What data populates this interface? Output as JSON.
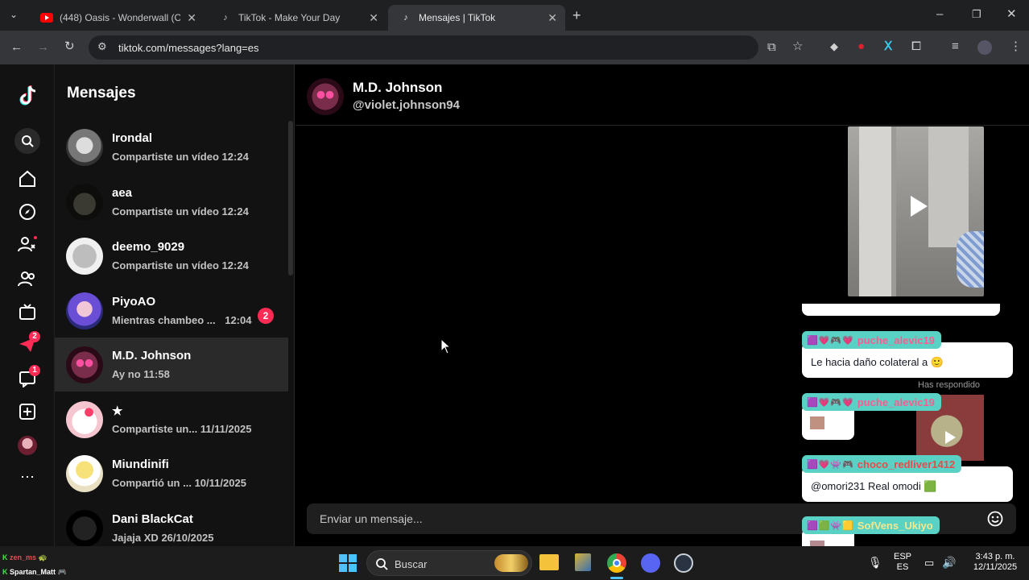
{
  "browser": {
    "tabs": [
      {
        "title": "(448) Oasis - Wonderwall (Offic",
        "icon": "youtube-icon"
      },
      {
        "title": "TikTok - Make Your Day",
        "icon": "tiktok-icon"
      },
      {
        "title": "Mensajes | TikTok",
        "icon": "tiktok-icon",
        "active": true
      }
    ],
    "url": "tiktok.com/messages?lang=es"
  },
  "nav": {
    "badges": {
      "inbox": "2",
      "activity": "1"
    }
  },
  "conversations": {
    "title": "Mensajes",
    "items": [
      {
        "name": "Irondal",
        "preview": "Compartiste un vídeo",
        "time": "12:24"
      },
      {
        "name": "aea",
        "preview": "Compartiste un vídeo",
        "time": "12:24"
      },
      {
        "name": "deemo_9029",
        "preview": "Compartiste un vídeo",
        "time": "12:24"
      },
      {
        "name": "PiyoAO",
        "preview": "Mientras chambeo ...",
        "time": "12:04",
        "unread": "2"
      },
      {
        "name": "M.D. Johnson",
        "preview": "Ay no",
        "time": "11:58",
        "selected": true
      },
      {
        "name": "★",
        "preview": "Compartiste un...",
        "time": "11/11/2025"
      },
      {
        "name": "Miundinifi",
        "preview": "Compartió un ...",
        "time": "10/11/2025"
      },
      {
        "name": "Dani BlackCat",
        "preview": "Jajaja XD",
        "time": "26/10/2025"
      }
    ]
  },
  "chat": {
    "name": "M.D. Johnson",
    "handle": "@violet.johnson94",
    "replied_label": "Has respondido",
    "composer_placeholder": "Enviar un mensaje..."
  },
  "stream_overlay": {
    "messages": [
      {
        "user": "puche_alevic19",
        "emotes": "🟪💗🎮💗",
        "text": "Le hacia daño colateral a 🙂"
      },
      {
        "user": "puche_alevic19",
        "emotes": "🟪💗🎮💗",
        "text": ""
      },
      {
        "user": "choco_redliver1412",
        "emotes": "🟪💗👾🎮",
        "text": "@omori231 Real omodi 🟩"
      },
      {
        "user": "SofVens_Ukiyo",
        "emotes": "🟪🟩👾🟨",
        "text": ""
      }
    ],
    "viewers": [
      {
        "name": "zen_ms",
        "icon": "🐢"
      },
      {
        "name": "Spartan_Matt",
        "icon": "🎮"
      }
    ]
  },
  "taskbar": {
    "search_label": "Buscar",
    "lang": "ESP",
    "lang_sub": "ES",
    "time": "3:43 p. m.",
    "date": "12/11/2025"
  }
}
